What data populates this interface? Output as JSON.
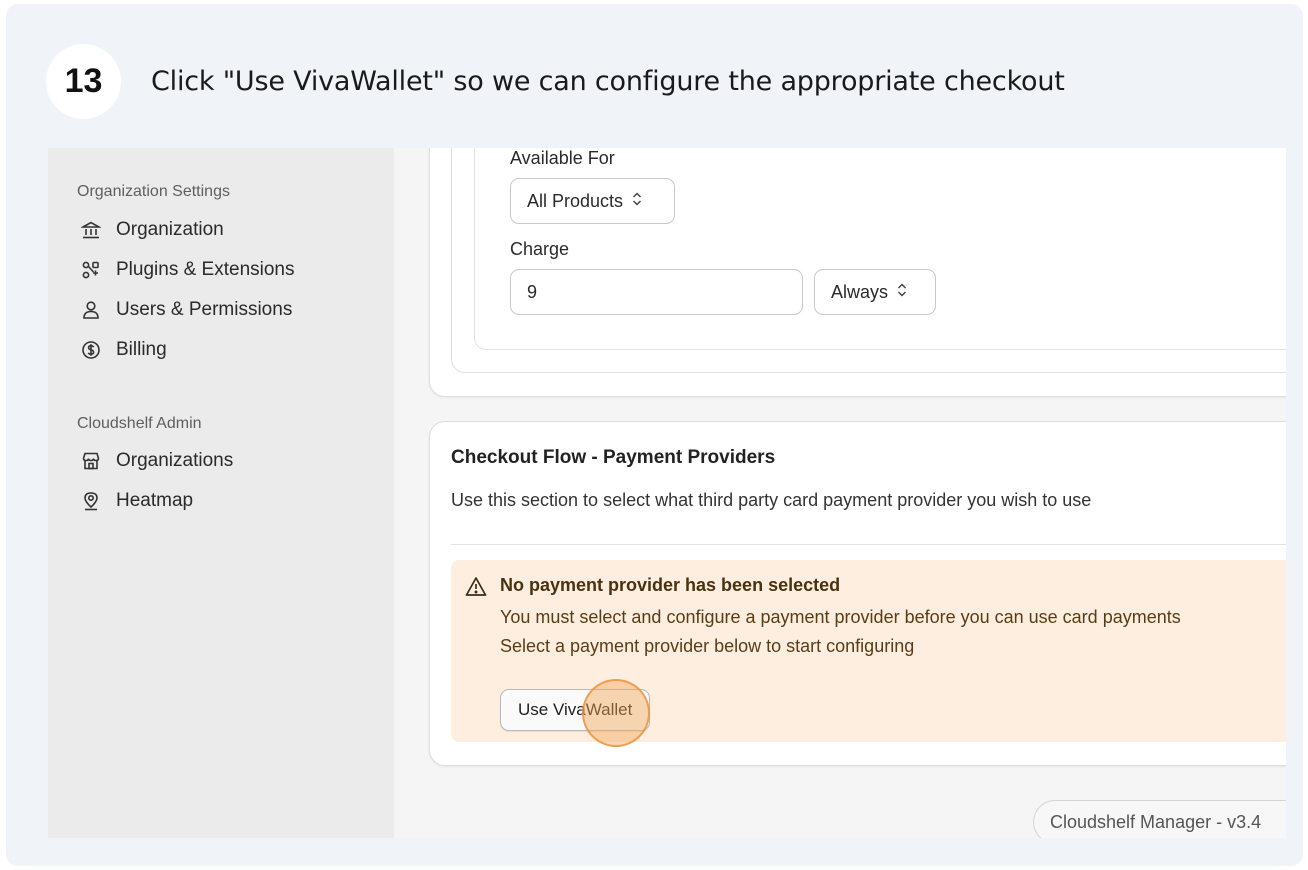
{
  "step": {
    "number": "13",
    "instruction": "Click \"Use VivaWallet\" so we can configure the appropriate checkout"
  },
  "sidebar": {
    "groups": [
      {
        "title": "Organization Settings",
        "items": [
          {
            "label": "Organization",
            "icon": "bank-icon"
          },
          {
            "label": "Plugins & Extensions",
            "icon": "puzzle-nodes-icon"
          },
          {
            "label": "Users & Permissions",
            "icon": "user-icon"
          },
          {
            "label": "Billing",
            "icon": "dollar-circle-icon"
          }
        ]
      },
      {
        "title": "Cloudshelf Admin",
        "items": [
          {
            "label": "Organizations",
            "icon": "store-icon"
          },
          {
            "label": "Heatmap",
            "icon": "location-pin-icon"
          }
        ]
      }
    ]
  },
  "fee_rule": {
    "available_for_label": "Available For",
    "available_for_value": "All Products",
    "charge_label": "Charge",
    "charge_value": "9",
    "charge_frequency": "Always"
  },
  "checkout_flow": {
    "title": "Checkout Flow - Payment Providers",
    "description": "Use this section to select what third party card payment provider you wish to use",
    "warning": {
      "title": "No payment provider has been selected",
      "line1": "You must select and configure a payment provider before you can use card payments",
      "line2": "Select a payment provider below to start configuring"
    },
    "button_label": "Use VivaWallet"
  },
  "footer": {
    "version_text": "Cloudshelf Manager - v3.4"
  },
  "colors": {
    "warning_bg": "#fdeee0",
    "click_marker": "#f4a656",
    "frame_bg": "#f0f3f8"
  }
}
